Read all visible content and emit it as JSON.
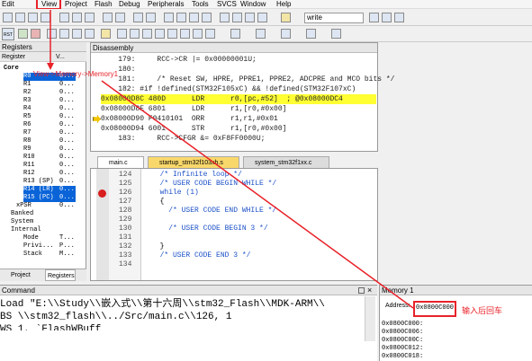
{
  "menu": [
    "Edit",
    "View",
    "Project",
    "Flash",
    "Debug",
    "Peripherals",
    "Tools",
    "SVCS",
    "Window",
    "Help"
  ],
  "toolbar": {
    "search_value": "write",
    "rst_label": "RST"
  },
  "annotation": {
    "view_path": "View->Memory->Memory1",
    "hint": "输入后回车"
  },
  "registers": {
    "title": "Registers",
    "col_register": "Register",
    "col_value": "V...",
    "rows": [
      {
        "name": "Core",
        "value": ""
      },
      {
        "name": "R0",
        "value": "0..."
      },
      {
        "name": "R1",
        "value": "0..."
      },
      {
        "name": "R2",
        "value": "0..."
      },
      {
        "name": "R3",
        "value": "0..."
      },
      {
        "name": "R4",
        "value": "0..."
      },
      {
        "name": "R5",
        "value": "0..."
      },
      {
        "name": "R6",
        "value": "0..."
      },
      {
        "name": "R7",
        "value": "0..."
      },
      {
        "name": "R8",
        "value": "0..."
      },
      {
        "name": "R9",
        "value": "0..."
      },
      {
        "name": "R10",
        "value": "0..."
      },
      {
        "name": "R11",
        "value": "0..."
      },
      {
        "name": "R12",
        "value": "0..."
      },
      {
        "name": "R13 (SP)",
        "value": "0..."
      },
      {
        "name": "R14 (LR)",
        "value": "0..."
      },
      {
        "name": "R15 (PC)",
        "value": "0..."
      },
      {
        "name": "xPSR",
        "value": "0..."
      },
      {
        "name": "Banked",
        "value": ""
      },
      {
        "name": "System",
        "value": ""
      },
      {
        "name": "Internal",
        "value": ""
      },
      {
        "name": "Mode",
        "value": "T..."
      },
      {
        "name": "Privi...",
        "value": "P..."
      },
      {
        "name": "Stack",
        "value": "M..."
      }
    ],
    "tab_project": "Project",
    "tab_registers": "Registers"
  },
  "disassembly": {
    "title": "Disassembly",
    "rows": [
      {
        "text": "    179:     RCC->CR |= 0x00000001U;",
        "style": "plain"
      },
      {
        "text": "    180:",
        "style": "plain"
      },
      {
        "text": "    181:     /* Reset SW, HPRE, PPRE1, PPRE2, ADCPRE and MCO bits */",
        "style": "plain"
      },
      {
        "text": "    182: #if !defined(STM32F105xC) && !defined(STM32F107xC)",
        "style": "plain"
      },
      {
        "text": "0x08000D8C 480D      LDR      r0,[pc,#52]  ; @0x08000DC4",
        "style": "hl"
      },
      {
        "text": "0x08000D8E 6801      LDR      r1,[r0,#0x00]",
        "style": "plain"
      },
      {
        "text": "0x08000D90 F0410101  ORR      r1,r1,#0x01",
        "style": "arrow"
      },
      {
        "text": "0x08000D94 6001      STR      r1,[r0,#0x00]",
        "style": "plain"
      },
      {
        "text": "    183:     RCC->CFGR &= 0xF8FF0000U;",
        "style": "plain"
      }
    ]
  },
  "tabs": [
    {
      "label": "main.c"
    },
    {
      "label": "startup_stm32f103xb.s"
    },
    {
      "label": "system_stm32f1xx.c"
    }
  ],
  "code": [
    {
      "line": "124",
      "text": "  /* Infinite loop */",
      "cls": "cmt",
      "bp": false
    },
    {
      "line": "125",
      "text": "  /* USER CODE BEGIN WHILE */",
      "cls": "cmt",
      "bp": false
    },
    {
      "line": "126",
      "text": "  while (1)",
      "cls": "kw",
      "bp": true
    },
    {
      "line": "127",
      "text": "  {",
      "cls": "",
      "bp": false
    },
    {
      "line": "128",
      "text": "    /* USER CODE END WHILE */",
      "cls": "cmt",
      "bp": false
    },
    {
      "line": "129",
      "text": "",
      "cls": "",
      "bp": false
    },
    {
      "line": "130",
      "text": "    /* USER CODE BEGIN 3 */",
      "cls": "cmt",
      "bp": false
    },
    {
      "line": "131",
      "text": "",
      "cls": "",
      "bp": false
    },
    {
      "line": "132",
      "text": "  }",
      "cls": "",
      "bp": false
    },
    {
      "line": "133",
      "text": "  /* USER CODE END 3 */",
      "cls": "cmt",
      "bp": false
    },
    {
      "line": "134",
      "text": "",
      "cls": "",
      "bp": false
    }
  ],
  "command": {
    "title": "Command",
    "lines": [
      "Load \"E:\\\\Study\\\\嵌入式\\\\第十六周\\\\stm32_Flash\\\\MDK-ARM\\\\",
      "BS \\\\stm32_flash\\\\../Src/main.c\\\\126, 1",
      "WS 1, `FlashWBuff"
    ]
  },
  "memory": {
    "title": "Memory 1",
    "address_label": "Address:",
    "address_value": "0x0800C000",
    "rows": [
      "0x0800C000:",
      "0x0800C006:",
      "0x0800C00C:",
      "0x0800C012:",
      "0x0800C018:"
    ]
  }
}
